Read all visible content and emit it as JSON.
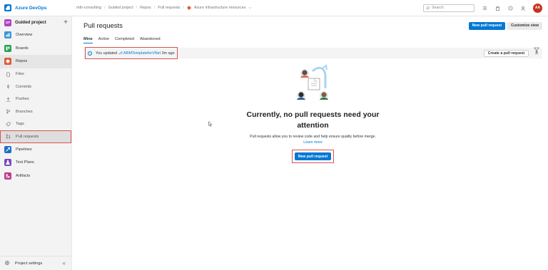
{
  "brand": {
    "name": "Azure DevOps"
  },
  "breadcrumbs": [
    "mth-consulting",
    "Guided project",
    "Repos",
    "Pull requests",
    "Azure Infrastructure resources"
  ],
  "search": {
    "placeholder": "Search"
  },
  "user": {
    "initials": "AA"
  },
  "sidebar": {
    "project_badge": "GP",
    "project_name": "Guided project",
    "add_symbol": "+",
    "items": [
      {
        "label": "Overview",
        "icon": "overview-icon",
        "color": "#3a96dd"
      },
      {
        "label": "Boards",
        "icon": "boards-icon",
        "color": "#2aa058"
      },
      {
        "label": "Repos",
        "icon": "repos-icon",
        "color": "#e05a3a"
      },
      {
        "label": "Files",
        "icon": "file-icon"
      },
      {
        "label": "Commits",
        "icon": "commit-icon"
      },
      {
        "label": "Pushes",
        "icon": "push-icon"
      },
      {
        "label": "Branches",
        "icon": "branch-icon"
      },
      {
        "label": "Tags",
        "icon": "tag-icon"
      },
      {
        "label": "Pull requests",
        "icon": "pull-request-icon"
      },
      {
        "label": "Pipelines",
        "icon": "pipelines-icon",
        "color": "#1d6fc6"
      },
      {
        "label": "Test Plans",
        "icon": "test-plans-icon",
        "color": "#7b4bc2"
      },
      {
        "label": "Artifacts",
        "icon": "artifacts-icon",
        "color": "#c13a8c"
      }
    ],
    "footer_label": "Project settings",
    "collapse_symbol": "«"
  },
  "main": {
    "title": "Pull requests",
    "new_pr_button": "New pull request",
    "customize_button": "Customize view",
    "tabs": [
      "Mine",
      "Active",
      "Completed",
      "Abandoned"
    ],
    "banner": {
      "prefix": "You updated ",
      "branch": "ARMTemplateforVNet",
      "suffix": " 3m ago",
      "create_button": "Create a pull request",
      "close_symbol": "✕"
    },
    "empty": {
      "title": "Currently, no pull requests need your attention",
      "description": "Pull requests allow you to review code and help ensure quality before merge.",
      "learn_more": "Learn more",
      "button": "New pull request"
    }
  },
  "colors": {
    "accent": "#0078d4",
    "highlight_box": "#d9534f"
  }
}
